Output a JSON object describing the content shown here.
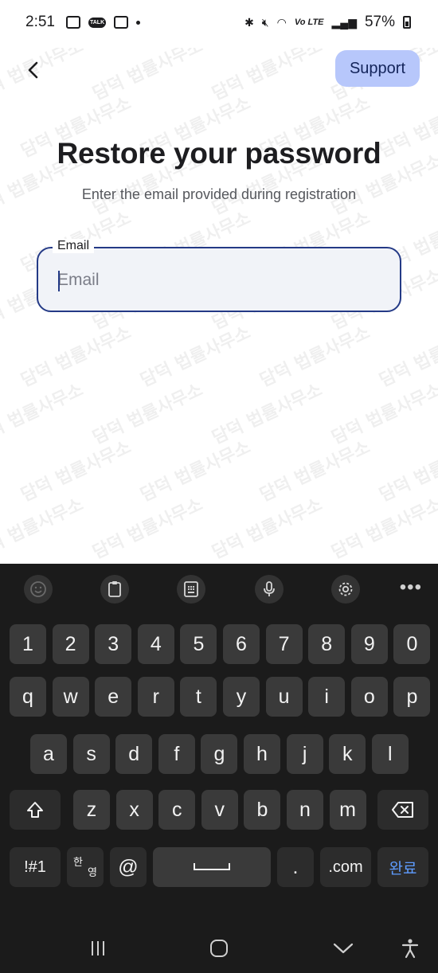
{
  "status_bar": {
    "time": "2:51",
    "talk_label": "TALK",
    "network_label": "Vo LTE",
    "battery": "57%"
  },
  "header": {
    "back_icon": "chevron-left-icon",
    "support_label": "Support"
  },
  "page": {
    "title": "Restore your password",
    "subtitle": "Enter the email provided during registration"
  },
  "email_field": {
    "label": "Email",
    "placeholder": "Email",
    "value": ""
  },
  "watermark": {
    "text": "담덕 법률사무소"
  },
  "keyboard": {
    "toolbar": [
      "emoji-icon",
      "clipboard-icon",
      "keypad-icon",
      "microphone-icon",
      "settings-icon",
      "more-icon"
    ],
    "row_numbers": [
      "1",
      "2",
      "3",
      "4",
      "5",
      "6",
      "7",
      "8",
      "9",
      "0"
    ],
    "row_1": [
      "q",
      "w",
      "e",
      "r",
      "t",
      "y",
      "u",
      "i",
      "o",
      "p"
    ],
    "row_2": [
      "a",
      "s",
      "d",
      "f",
      "g",
      "h",
      "j",
      "k",
      "l"
    ],
    "row_3": [
      "z",
      "x",
      "c",
      "v",
      "b",
      "n",
      "m"
    ],
    "symbols_label": "!#1",
    "lang_top": "한",
    "lang_bottom": "영",
    "at_label": "@",
    "period_label": ".",
    "dotcom_label": ".com",
    "done_label": "완료"
  },
  "nav_bar": [
    "recents-icon",
    "home-icon",
    "hide-keyboard-icon",
    "accessibility-icon"
  ]
}
